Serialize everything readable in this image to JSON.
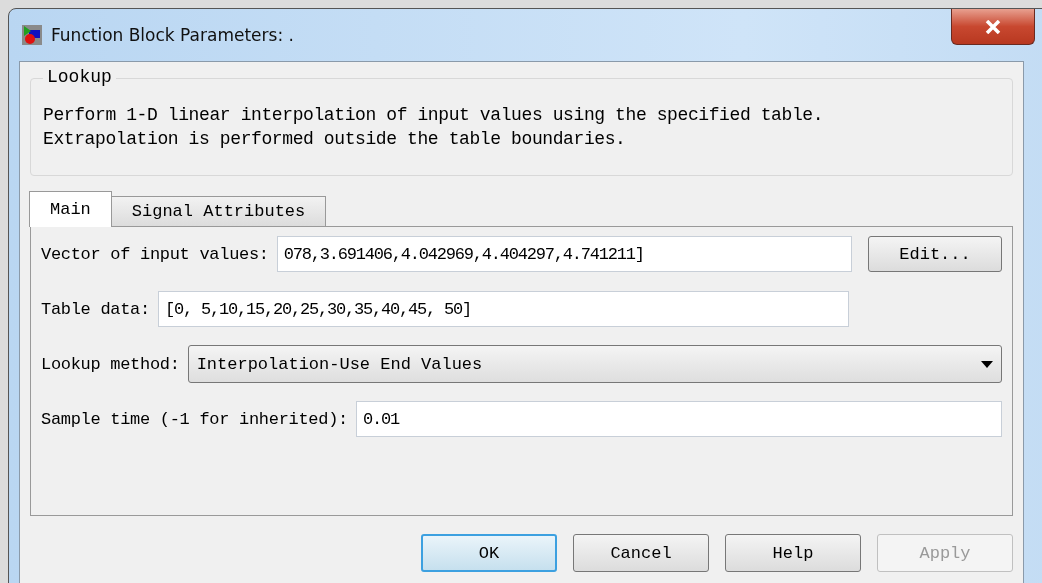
{
  "window": {
    "title": "Function Block Parameters: ."
  },
  "group": {
    "title": "Lookup",
    "description": "Perform 1-D linear interpolation of input values using the specified table.\nExtrapolation is performed outside the table boundaries."
  },
  "tabs": [
    {
      "label": "Main",
      "selected": true
    },
    {
      "label": "Signal Attributes",
      "selected": false
    }
  ],
  "fields": [
    {
      "kind": "text",
      "label": "Vector of input values:",
      "value": "078,3.691406,4.042969,4.404297,4.741211]",
      "button": "Edit..."
    },
    {
      "kind": "text",
      "label": "Table data:",
      "value": "[0,  5,10,15,20,25,30,35,40,45,  50]"
    },
    {
      "kind": "dropdown",
      "label": "Lookup method:",
      "value": "Interpolation-Use End Values"
    },
    {
      "kind": "text",
      "label": "Sample time (-1 for inherited):",
      "value": "0.01"
    }
  ],
  "buttons": [
    {
      "label": "OK",
      "default": true,
      "disabled": false
    },
    {
      "label": "Cancel",
      "default": false,
      "disabled": false
    },
    {
      "label": "Help",
      "default": false,
      "disabled": false
    },
    {
      "label": "Apply",
      "default": false,
      "disabled": true
    }
  ]
}
